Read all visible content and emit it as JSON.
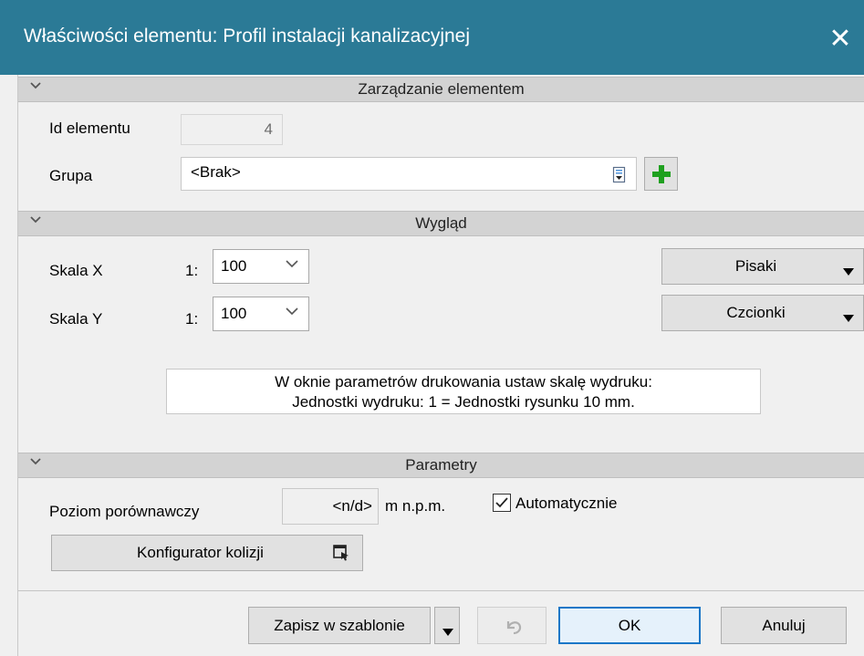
{
  "window": {
    "title": "Właściwości elementu: Profil instalacji kanalizacyjnej",
    "close_icon": "close-icon"
  },
  "section_management": {
    "title": "Zarządzanie elementem",
    "id_label": "Id elementu",
    "id_value": "4",
    "group_label": "Grupa",
    "group_value": "<Brak>"
  },
  "section_appearance": {
    "title": "Wygląd",
    "scale_x_label": "Skala X",
    "scale_y_label": "Skala Y",
    "scale_prefix": "1:",
    "scale_x_value": "100",
    "scale_y_value": "100",
    "pens_label": "Pisaki",
    "fonts_label": "Czcionki",
    "info_line1": "W oknie parametrów drukowania ustaw skalę wydruku:",
    "info_line2": "Jednostki wydruku: 1 = Jednostki rysunku 10 mm."
  },
  "section_params": {
    "title": "Parametry",
    "level_label": "Poziom porównawczy",
    "level_value": "<n/d>",
    "level_unit": "m n.p.m.",
    "auto_label": "Automatycznie",
    "auto_checked": true,
    "collision_button": "Konfigurator kolizji"
  },
  "footer": {
    "save_template": "Zapisz w szablonie",
    "ok": "OK",
    "cancel": "Anuluj"
  },
  "colors": {
    "titlebar": "#2b7a96",
    "section_header": "#d3d3d3",
    "default_button_border": "#1c77c7",
    "add_icon_green": "#1fa01f"
  }
}
